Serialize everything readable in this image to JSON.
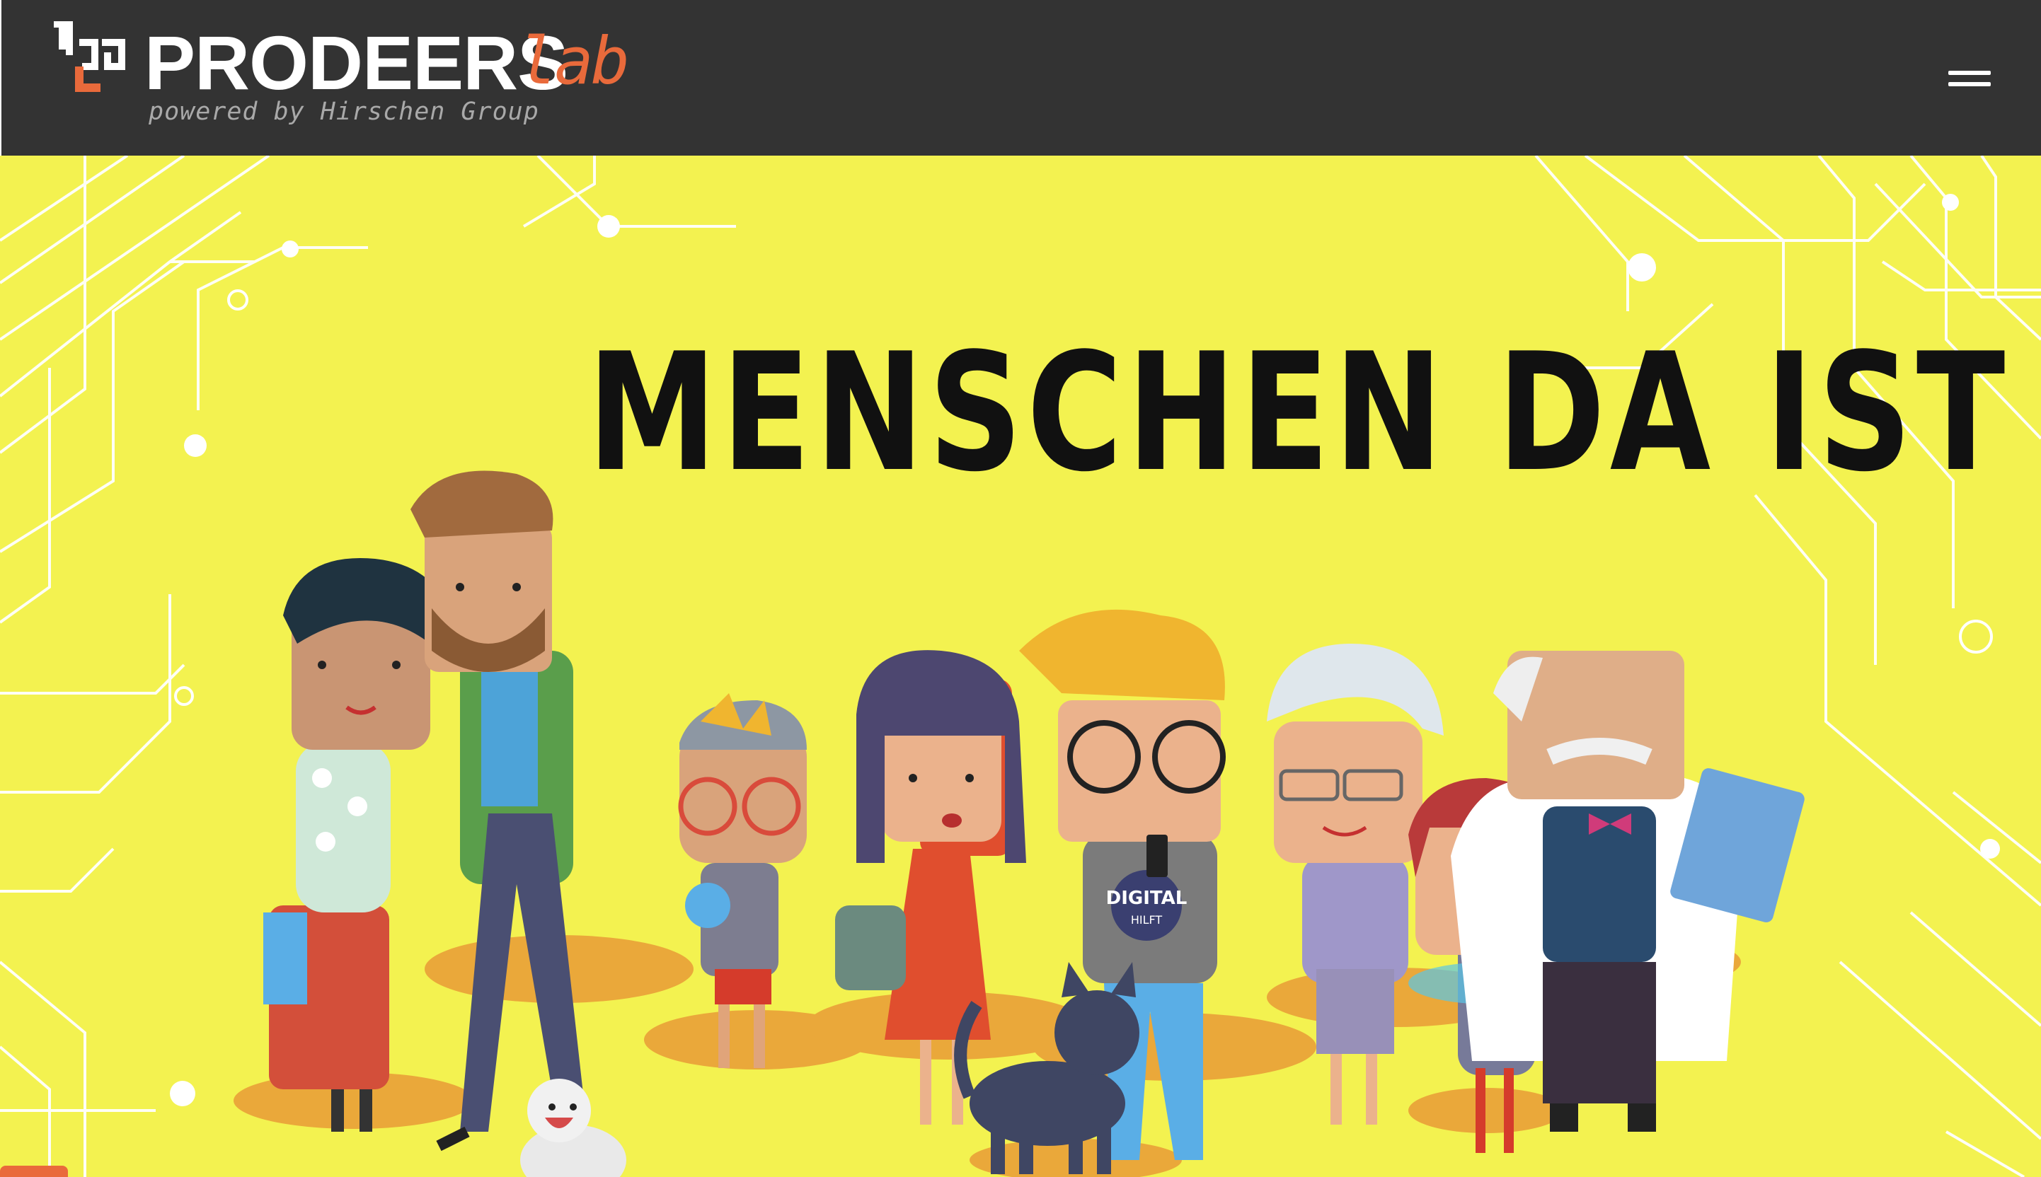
{
  "header": {
    "brand_name": "PRODEERS",
    "brand_suffix": "lab",
    "tagline": "powered by Hirschen Group",
    "menu_icon": "hamburger-menu-icon"
  },
  "hero": {
    "headline": "MENSCHEN DA IST",
    "shirt_text": "DIGITAL",
    "shirt_subtext": "HILFT"
  },
  "colors": {
    "header_bg": "#333333",
    "hero_bg": "#f3f250",
    "accent": "#e96a3b",
    "text_dark": "#111111",
    "white": "#ffffff"
  }
}
